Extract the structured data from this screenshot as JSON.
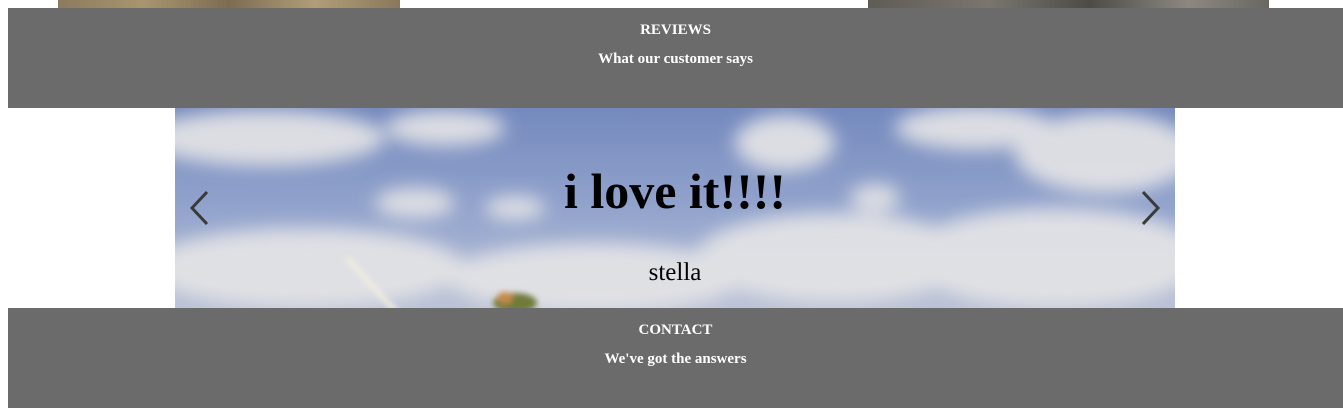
{
  "reviews": {
    "title": "REVIEWS",
    "subtitle": "What our customer says"
  },
  "carousel": {
    "quote": "i love it!!!!",
    "author": "stella",
    "prev_icon": "chevron-left-icon",
    "next_icon": "chevron-right-icon"
  },
  "contact": {
    "title": "CONTACT",
    "subtitle": "We've got the answers"
  },
  "colors": {
    "band_background": "#6b6b6b",
    "band_text": "#ffffff",
    "sky": "#7f94c4",
    "arrow": "#3a3a3a"
  }
}
